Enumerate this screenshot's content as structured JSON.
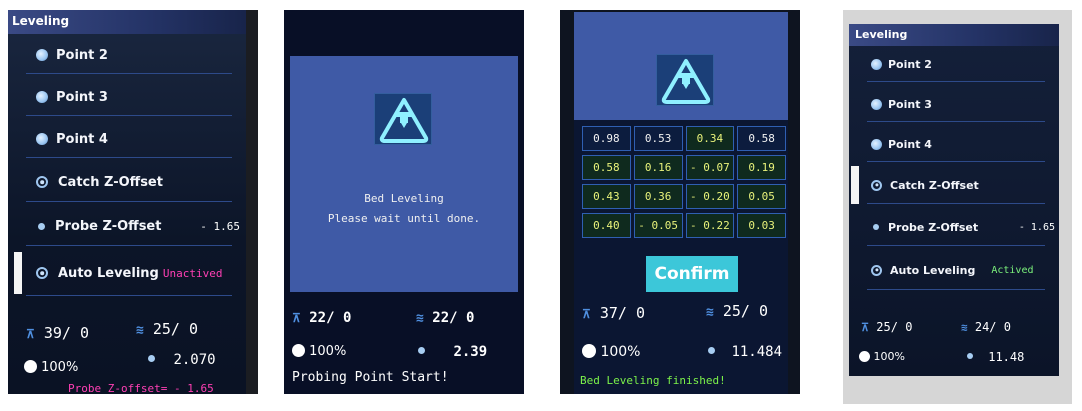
{
  "screens": [
    {
      "header": "Leveling",
      "items": [
        {
          "label": "Point 2",
          "icon": "point-bullet-icon"
        },
        {
          "label": "Point 3",
          "icon": "point-bullet-icon"
        },
        {
          "label": "Point 4",
          "icon": "point-bullet-icon"
        },
        {
          "label": "Catch Z-Offset",
          "icon": "radio-ring-icon"
        },
        {
          "label": "Probe Z-Offset",
          "icon": "small-dot-icon",
          "value": "- 1.65"
        },
        {
          "label": "Auto Leveling",
          "icon": "radio-ring-icon",
          "status": "Unactived"
        }
      ],
      "status": {
        "z": "39/  0",
        "bed": "25/  0",
        "fan": "100%",
        "zpos": "2.070"
      },
      "footer": "Probe Z-offset= - 1.65"
    },
    {
      "title": "Bed Leveling",
      "message": "Please wait until done.",
      "status": {
        "z": "22/  0",
        "bed": "22/  0",
        "fan": "100%",
        "zpos": "2.39"
      },
      "footer": "Probing Point Start!"
    },
    {
      "mesh": [
        [
          "0.98",
          "0.53",
          "0.34",
          "0.58"
        ],
        [
          "0.58",
          "0.16",
          "- 0.07",
          "0.19"
        ],
        [
          "0.43",
          "0.36",
          "- 0.20",
          "0.05"
        ],
        [
          "0.40",
          "- 0.05",
          "- 0.22",
          "0.03"
        ]
      ],
      "confirm": "Confirm",
      "status": {
        "z": "37/  0",
        "bed": "25/  0",
        "fan": "100%",
        "zpos": "11.484"
      },
      "footer": "Bed Leveling finished!"
    },
    {
      "header": "Leveling",
      "items": [
        {
          "label": "Point 2"
        },
        {
          "label": "Point 3"
        },
        {
          "label": "Point 4"
        },
        {
          "label": "Catch Z-Offset"
        },
        {
          "label": "Probe Z-Offset",
          "value": "- 1.65"
        },
        {
          "label": "Auto Leveling",
          "status": "Actived"
        }
      ],
      "status": {
        "z": "25/  0",
        "bed": "24/  0",
        "fan": "100%",
        "zpos": "11.48"
      }
    }
  ],
  "colors": {
    "accent": "#4f8fe0",
    "unactived": "#ff3fb4",
    "actived": "#7cf27c",
    "finished": "#7cf24a",
    "confirm": "#3cc7d9"
  },
  "icons": {
    "z": "z-axis-icon",
    "bed": "bed-heat-icon",
    "fan": "fan-icon",
    "probe": "probe-logo-icon"
  }
}
